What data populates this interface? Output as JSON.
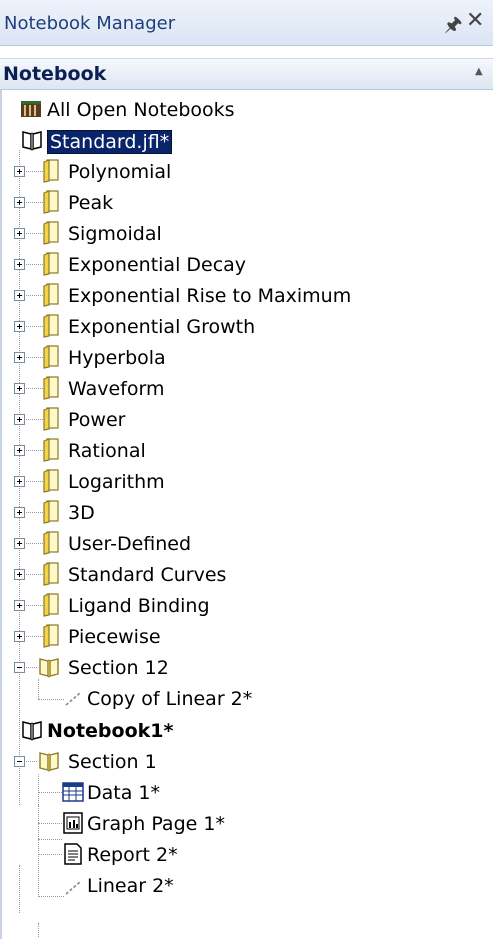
{
  "panel": {
    "title": "Notebook Manager",
    "pin_icon": "pin-icon",
    "close_icon": "close-icon"
  },
  "section_header": {
    "label": "Notebook",
    "collapse_icon": "collapse-caret-icon"
  },
  "tree": {
    "all_open": "All Open Notebooks",
    "standard": {
      "label": "Standard.jfl*",
      "sections": [
        "Polynomial",
        "Peak",
        "Sigmoidal",
        "Exponential Decay",
        "Exponential Rise to Maximum",
        "Exponential Growth",
        "Hyperbola",
        "Waveform",
        "Power",
        "Rational",
        "Logarithm",
        "3D",
        "User-Defined",
        "Standard Curves",
        "Ligand Binding",
        "Piecewise"
      ],
      "section12": {
        "label": "Section 12",
        "child": "Copy of Linear 2*"
      }
    },
    "notebook1": {
      "label": "Notebook1*",
      "section1": {
        "label": "Section 1",
        "items": [
          "Data 1*",
          "Graph Page 1*",
          "Report 2*",
          "Linear 2*"
        ]
      }
    }
  }
}
